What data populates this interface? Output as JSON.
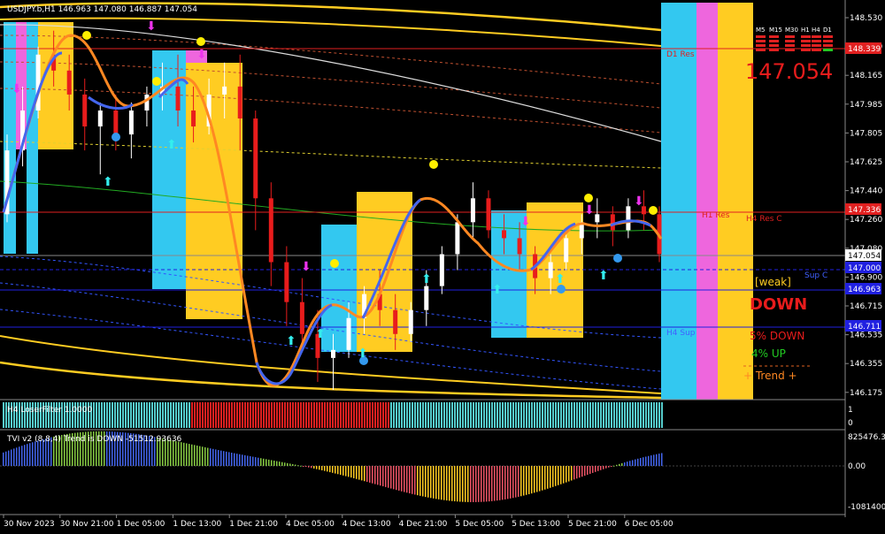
{
  "chart_data": [
    {
      "type": "candlestick",
      "symbol_label": "USDJPY.b,H1  146.963 147.080 146.887 147.054",
      "price_axis_ticks": [
        "148.530",
        "148.350",
        "148.165",
        "147.985",
        "147.805",
        "147.625",
        "147.440",
        "147.260",
        "147.080",
        "146.900",
        "146.715",
        "146.535",
        "146.355",
        "146.175"
      ],
      "current_price_tag": "147.054",
      "current_price_big": "147.054",
      "tags": {
        "red_top": "148.339",
        "red_mid": "147.336",
        "blue_1": "147.000",
        "blue_2": "146.963",
        "blue_3": "146.711"
      },
      "level_labels": {
        "d1_res": "D1 Res",
        "h1_res": "H1 Res",
        "h4_res": "H4 Res C",
        "h4_sup": "H4 Sup",
        "sup_c": "Sup C"
      },
      "timeframes": [
        "M5",
        "M15",
        "M30",
        "H1",
        "H4",
        "D1"
      ],
      "signal_panel": {
        "weak": "[weak]",
        "direction": "DOWN",
        "down_row": "5%  DOWN",
        "up_row": "4%   UP",
        "trend_row": "+   Trend   +"
      },
      "candles": [
        [
          147.3,
          147.8,
          147.25,
          147.7
        ],
        [
          147.7,
          148.1,
          147.6,
          147.95
        ],
        [
          147.95,
          148.35,
          147.9,
          148.3
        ],
        [
          148.3,
          148.45,
          148.1,
          148.2
        ],
        [
          148.2,
          148.3,
          147.95,
          148.05
        ],
        [
          148.05,
          148.15,
          147.7,
          147.85
        ],
        [
          147.85,
          148.0,
          147.55,
          147.95
        ],
        [
          147.95,
          148.05,
          147.7,
          147.8
        ],
        [
          147.8,
          148.0,
          147.65,
          147.95
        ],
        [
          147.95,
          148.1,
          147.85,
          148.05
        ],
        [
          148.05,
          148.25,
          147.95,
          148.1
        ],
        [
          148.1,
          148.3,
          147.85,
          147.95
        ],
        [
          147.95,
          148.1,
          147.75,
          147.85
        ],
        [
          147.85,
          148.15,
          147.8,
          148.05
        ],
        [
          148.05,
          148.25,
          147.9,
          148.1
        ],
        [
          148.1,
          148.3,
          147.7,
          147.9
        ],
        [
          147.9,
          147.95,
          147.2,
          147.4
        ],
        [
          147.4,
          147.5,
          146.85,
          147.0
        ],
        [
          147.0,
          147.1,
          146.6,
          146.75
        ],
        [
          146.75,
          146.9,
          146.45,
          146.55
        ],
        [
          146.55,
          146.7,
          146.25,
          146.4
        ],
        [
          146.4,
          146.55,
          146.2,
          146.45
        ],
        [
          146.45,
          146.75,
          146.4,
          146.65
        ],
        [
          146.65,
          146.85,
          146.55,
          146.8
        ],
        [
          146.8,
          146.95,
          146.6,
          146.7
        ],
        [
          146.7,
          146.8,
          146.45,
          146.55
        ],
        [
          146.55,
          146.75,
          146.5,
          146.7
        ],
        [
          146.7,
          146.95,
          146.6,
          146.85
        ],
        [
          146.85,
          147.1,
          146.8,
          147.05
        ],
        [
          147.05,
          147.3,
          146.95,
          147.25
        ],
        [
          147.25,
          147.5,
          147.15,
          147.4
        ],
        [
          147.4,
          147.45,
          147.15,
          147.2
        ],
        [
          147.2,
          147.3,
          147.05,
          147.15
        ],
        [
          147.15,
          147.25,
          146.95,
          147.05
        ],
        [
          147.05,
          147.1,
          146.8,
          146.9
        ],
        [
          146.9,
          147.05,
          146.8,
          147.0
        ],
        [
          147.0,
          147.2,
          146.95,
          147.15
        ],
        [
          147.15,
          147.3,
          147.05,
          147.25
        ],
        [
          147.25,
          147.4,
          147.15,
          147.3
        ],
        [
          147.3,
          147.35,
          147.1,
          147.2
        ],
        [
          147.2,
          147.4,
          147.15,
          147.35
        ],
        [
          147.35,
          147.45,
          147.2,
          147.3
        ],
        [
          147.3,
          147.35,
          147.0,
          147.05
        ]
      ],
      "lower_panel_1": {
        "label": "H4 LoserFilter 1.0000"
      },
      "lower_panel_2": {
        "label": "TVI v2 (8,8,4)  Trend is DOWN  -51512.93636",
        "axis_ticks": [
          "825476.35",
          "0.00",
          "-1081400."
        ]
      },
      "time_axis_labels": [
        "30 Nov 2023",
        "30 Nov 21:00",
        "1 Dec 05:00",
        "1 Dec 13:00",
        "1 Dec 21:00",
        "4 Dec 05:00",
        "4 Dec 13:00",
        "4 Dec 21:00",
        "5 Dec 05:00",
        "5 Dec 13:00",
        "5 Dec 21:00",
        "6 Dec 05:00"
      ],
      "colors": {
        "bull": "#ffffff",
        "bear": "#e81c1c",
        "cyan": "#33c8f0",
        "pink": "#ee66dd",
        "gold": "#ffcc22",
        "res_line": "#e02020",
        "sup_line": "#2020e0"
      }
    }
  ]
}
